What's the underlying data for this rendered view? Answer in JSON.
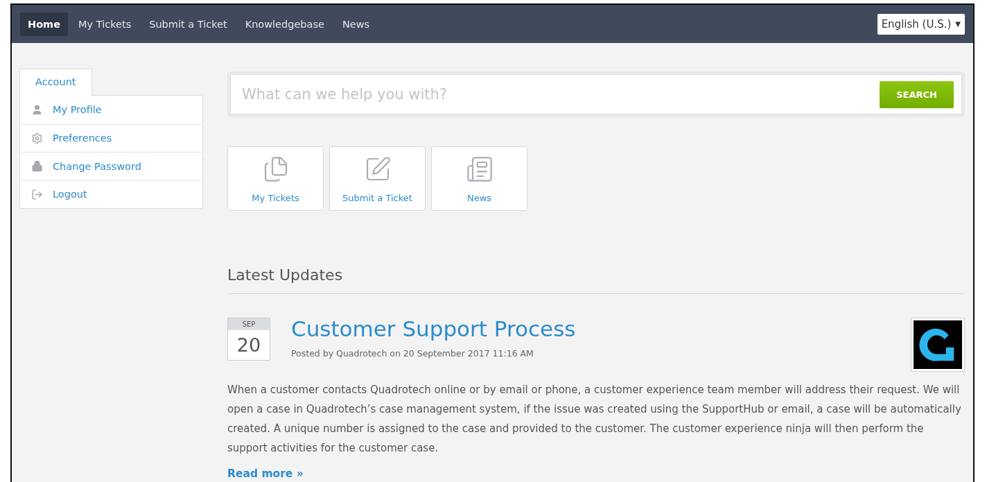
{
  "nav": {
    "items": [
      {
        "label": "Home",
        "selected": true
      },
      {
        "label": "My Tickets",
        "selected": false
      },
      {
        "label": "Submit a Ticket",
        "selected": false
      },
      {
        "label": "Knowledgebase",
        "selected": false
      },
      {
        "label": "News",
        "selected": false
      }
    ],
    "language": {
      "value": "English (U.S.)",
      "caret": "▼"
    }
  },
  "sidebar": {
    "tab": "Account",
    "items": [
      {
        "kind": "profile",
        "label": "My Profile"
      },
      {
        "kind": "preferences",
        "label": "Preferences"
      },
      {
        "kind": "password",
        "label": "Change Password"
      },
      {
        "kind": "logout",
        "label": "Logout"
      }
    ]
  },
  "search": {
    "placeholder": "What can we help you with?",
    "button": "SEARCH"
  },
  "tiles": [
    {
      "kind": "tickets",
      "label": "My Tickets"
    },
    {
      "kind": "submit",
      "label": "Submit a Ticket"
    },
    {
      "kind": "news",
      "label": "News"
    }
  ],
  "updates": {
    "heading": "Latest Updates",
    "posts": [
      {
        "month": "SEP",
        "day": "20",
        "title": "Customer Support Process",
        "meta": "Posted by Quadrotech on 20 September 2017 11:16 AM",
        "body": "When a customer contacts Quadrotech online or by email or phone, a customer experience team member will address their request. We will open a case in Quadrotech’s case management system, if the issue was created using the SupportHub or email, a case will be automatically created. A unique number is assigned to the case and provided to the customer. The customer experience ninja will then perform the support activities for the customer case.",
        "link": "Read more »"
      }
    ]
  }
}
